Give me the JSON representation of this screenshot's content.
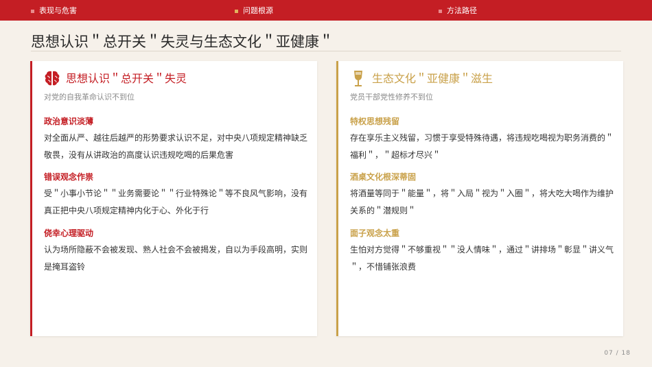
{
  "nav": {
    "items": [
      {
        "label": "表现与危害",
        "active": false
      },
      {
        "label": "问题根源",
        "active": true
      },
      {
        "label": "方法路径",
        "active": false
      }
    ]
  },
  "page": {
    "title": "思想认识＂总开关＂失灵与生态文化＂亚健康＂",
    "number": "07 / 18"
  },
  "colors": {
    "primary": "#c41e24",
    "accent": "#c9a14a",
    "background": "#f6f1ea"
  },
  "cards": [
    {
      "icon": "brain-icon",
      "title": "思想认识＂总开关＂失灵",
      "subtitle": "对党的自我革命认识不到位",
      "sections": [
        {
          "title": "政治意识淡薄",
          "text": "对全面从严、越往后越严的形势要求认识不足，对中央八项规定精神缺乏敬畏，没有从讲政治的高度认识违规吃喝的后果危害"
        },
        {
          "title": "错误观念作祟",
          "text": "受＂小事小节论＂＂业务需要论＂＂行业特殊论＂等不良风气影响，没有真正把中央八项规定精神内化于心、外化于行"
        },
        {
          "title": "侥幸心理驱动",
          "text": "认为场所隐蔽不会被发现、熟人社会不会被揭发，自以为手段高明，实则是掩耳盗铃"
        }
      ]
    },
    {
      "icon": "wine-glass-icon",
      "title": "生态文化＂亚健康＂滋生",
      "subtitle": "党员干部党性修养不到位",
      "sections": [
        {
          "title": "特权思想残留",
          "text": "存在享乐主义残留，习惯于享受特殊待遇，将违规吃喝视为职务消费的＂福利＂，＂超标才尽兴＂"
        },
        {
          "title": "酒桌文化根深蒂固",
          "text": "将酒量等同于＂能量＂，将＂入局＂视为＂入圈＂，将大吃大喝作为维护关系的＂潜规则＂"
        },
        {
          "title": "面子观念太重",
          "text": "生怕对方觉得＂不够重视＂＂没人情味＂，通过＂讲排场＂彰显＂讲义气＂，不惜铺张浪费"
        }
      ]
    }
  ]
}
